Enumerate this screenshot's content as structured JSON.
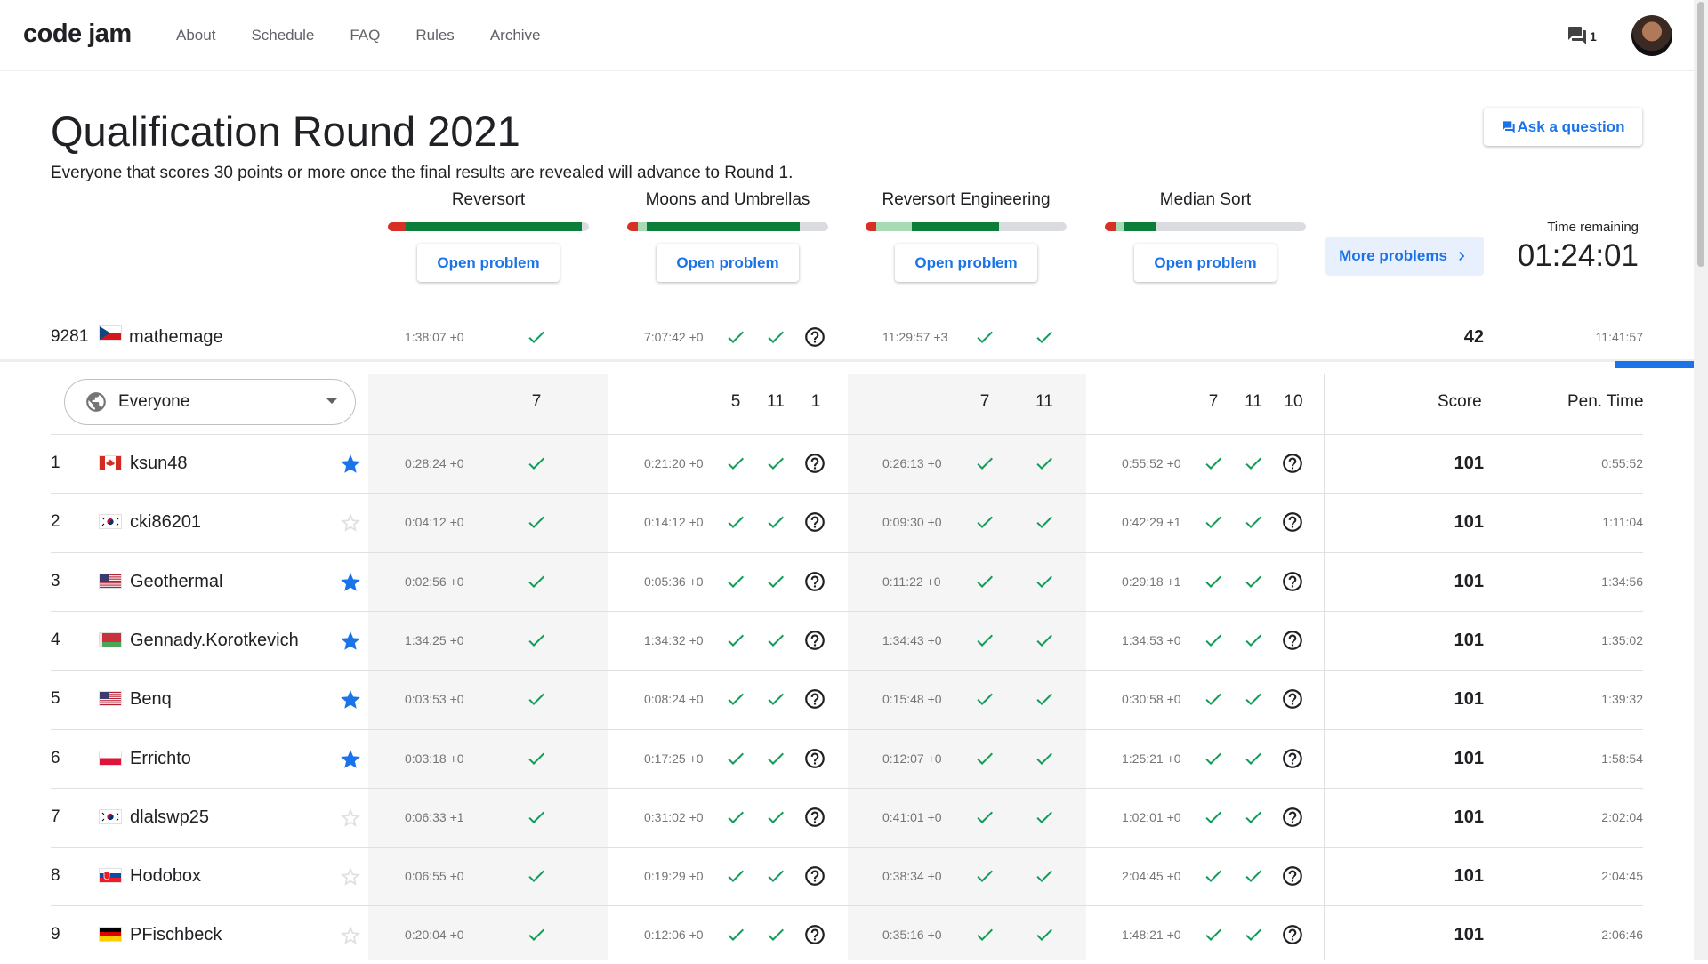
{
  "nav": {
    "logo": "code jam",
    "links": [
      "About",
      "Schedule",
      "FAQ",
      "Rules",
      "Archive"
    ],
    "chat_count": "1"
  },
  "header": {
    "title": "Qualification Round 2021",
    "subtitle": "Everyone that scores 30 points or more once the final results are revealed will advance to Round 1.",
    "ask_label": "Ask a question",
    "more_label": "More problems",
    "time_label": "Time remaining",
    "time_value": "01:24:01"
  },
  "problems": [
    {
      "name": "Reversort",
      "open_label": "Open problem",
      "tests": [
        "7"
      ]
    },
    {
      "name": "Moons and Umbrellas",
      "open_label": "Open problem",
      "tests": [
        "5",
        "11",
        "1"
      ]
    },
    {
      "name": "Reversort Engineering",
      "open_label": "Open problem",
      "tests": [
        "7",
        "11"
      ]
    },
    {
      "name": "Median Sort",
      "open_label": "Open problem",
      "tests": [
        "7",
        "11",
        "10"
      ]
    }
  ],
  "my_row": {
    "rank": "9281",
    "flag": "cz",
    "name": "mathemage",
    "times": [
      "1:38:07 +0",
      "7:07:42 +0",
      "11:29:57 +3",
      ""
    ],
    "score": "42",
    "penalty": "11:41:57"
  },
  "table": {
    "filter_label": "Everyone",
    "score_header": "Score",
    "penalty_header": "Pen. Time",
    "rows": [
      {
        "rank": "1",
        "flag": "ca",
        "name": "ksun48",
        "starred": true,
        "times": [
          "0:28:24 +0",
          "0:21:20 +0",
          "0:26:13 +0",
          "0:55:52 +0"
        ],
        "score": "101",
        "penalty": "0:55:52"
      },
      {
        "rank": "2",
        "flag": "kr",
        "name": "cki86201",
        "starred": false,
        "times": [
          "0:04:12 +0",
          "0:14:12 +0",
          "0:09:30 +0",
          "0:42:29 +1"
        ],
        "score": "101",
        "penalty": "1:11:04"
      },
      {
        "rank": "3",
        "flag": "us",
        "name": "Geothermal",
        "starred": true,
        "times": [
          "0:02:56 +0",
          "0:05:36 +0",
          "0:11:22 +0",
          "0:29:18 +1"
        ],
        "score": "101",
        "penalty": "1:34:56"
      },
      {
        "rank": "4",
        "flag": "by",
        "name": "Gennady.Korotkevich",
        "starred": true,
        "times": [
          "1:34:25 +0",
          "1:34:32 +0",
          "1:34:43 +0",
          "1:34:53 +0"
        ],
        "score": "101",
        "penalty": "1:35:02"
      },
      {
        "rank": "5",
        "flag": "us",
        "name": "Benq",
        "starred": true,
        "times": [
          "0:03:53 +0",
          "0:08:24 +0",
          "0:15:48 +0",
          "0:30:58 +0"
        ],
        "score": "101",
        "penalty": "1:39:32"
      },
      {
        "rank": "6",
        "flag": "pl",
        "name": "Errichto",
        "starred": true,
        "times": [
          "0:03:18 +0",
          "0:17:25 +0",
          "0:12:07 +0",
          "1:25:21 +0"
        ],
        "score": "101",
        "penalty": "1:58:54"
      },
      {
        "rank": "7",
        "flag": "kr",
        "name": "dlalswp25",
        "starred": false,
        "times": [
          "0:06:33 +1",
          "0:31:02 +0",
          "0:41:01 +0",
          "1:02:01 +0"
        ],
        "score": "101",
        "penalty": "2:02:04"
      },
      {
        "rank": "8",
        "flag": "sk",
        "name": "Hodobox",
        "starred": false,
        "times": [
          "0:06:55 +0",
          "0:19:29 +0",
          "0:38:34 +0",
          "2:04:45 +0"
        ],
        "score": "101",
        "penalty": "2:04:45"
      },
      {
        "rank": "9",
        "flag": "de",
        "name": "PFischbeck",
        "starred": false,
        "times": [
          "0:20:04 +0",
          "0:12:06 +0",
          "0:35:16 +0",
          "1:48:21 +0"
        ],
        "score": "101",
        "penalty": "2:06:46"
      }
    ]
  },
  "colors": {
    "accent": "#1a73e8",
    "check": "#0f9d58",
    "star": "#1a73e8",
    "bar_green": "#0d7e3a",
    "bar_red": "#d93025",
    "bar_light_green": "#a8dab5"
  }
}
